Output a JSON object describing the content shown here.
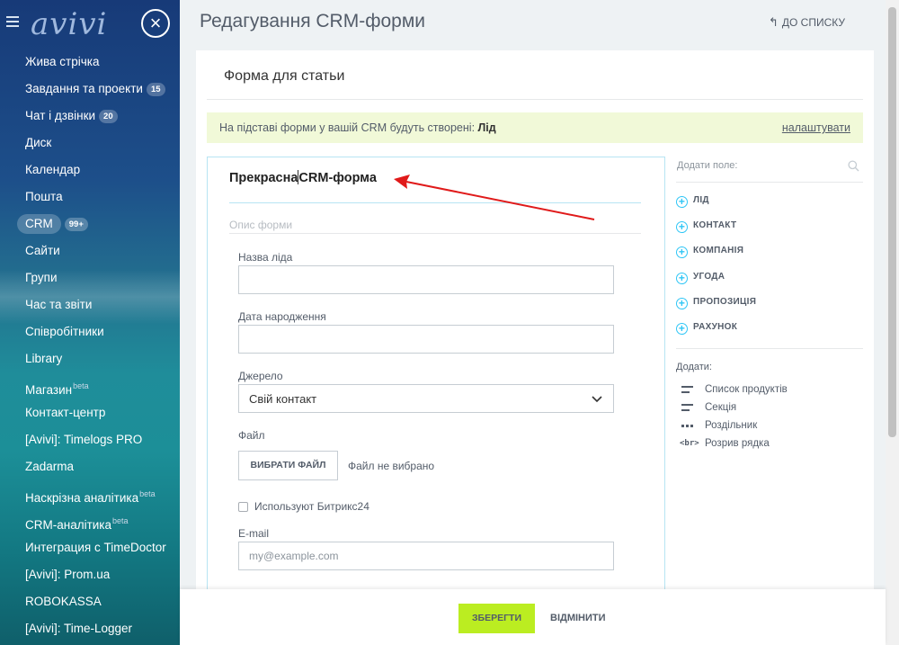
{
  "sidebar": {
    "logo": "avivi",
    "items": [
      {
        "label": "Жива стрічка"
      },
      {
        "label": "Завдання та проекти",
        "badge": "15"
      },
      {
        "label": "Чат і дзвінки",
        "badge": "20"
      },
      {
        "label": "Диск"
      },
      {
        "label": "Календар"
      },
      {
        "label": "Пошта"
      },
      {
        "label": "CRM",
        "badge": "99+"
      },
      {
        "label": "Сайти"
      },
      {
        "label": "Групи"
      },
      {
        "label": "Час та звіти"
      },
      {
        "label": "Співробітники"
      },
      {
        "label": "Library"
      },
      {
        "label": "Магазин",
        "sup": "beta"
      },
      {
        "label": "Контакт-центр"
      },
      {
        "label": "[Avivi]: Timelogs PRO"
      },
      {
        "label": "Zadarma"
      },
      {
        "label": "Наскрізна аналітика",
        "sup": "beta"
      },
      {
        "label": "CRM-аналітика",
        "sup": "beta"
      },
      {
        "label": "Интеграция с TimeDoctor"
      },
      {
        "label": "[Avivi]: Prom.ua"
      },
      {
        "label": "ROBOKASSA"
      },
      {
        "label": "[Avivi]: Time-Logger"
      }
    ]
  },
  "header": {
    "title": "Редагування CRM-форми",
    "back_label": "ДО СПИСКУ"
  },
  "card": {
    "title": "Форма для статьи",
    "info_text": "На підставі форми у вашій CRM будуть створені:",
    "info_entity": "Лід",
    "info_link": "налаштувати"
  },
  "form": {
    "name_before_cursor": "Прекрасна",
    "name_after_cursor": "CRM-форма",
    "description_placeholder": "Опис форми",
    "fields": {
      "lead_name_label": "Назва ліда",
      "birthdate_label": "Дата народження",
      "source_label": "Джерело",
      "source_value": "Свій контакт",
      "file_label": "Файл",
      "file_button": "ВИБРАТИ ФАЙЛ",
      "file_status": "Файл не вибрано",
      "checkbox_label": "Используют Битрикс24",
      "email_label": "E-mail",
      "email_placeholder": "my@example.com"
    }
  },
  "right_panel": {
    "search_placeholder": "Додати поле:",
    "entities": [
      "ЛІД",
      "КОНТАКТ",
      "КОМПАНІЯ",
      "УГОДА",
      "ПРОПОЗИЦІЯ",
      "РАХУНОК"
    ],
    "add_label": "Додати:",
    "extras": [
      {
        "label": "Список продуктів",
        "icon": "product-list-icon"
      },
      {
        "label": "Секція",
        "icon": "section-icon"
      },
      {
        "label": "Роздільник",
        "icon": "divider-icon"
      },
      {
        "label": "Розрив рядка",
        "icon": "line-break-icon",
        "icon_text": "<br>"
      }
    ]
  },
  "footer": {
    "save_label": "ЗБЕРЕГТИ",
    "cancel_label": "ВІДМІНИТИ"
  },
  "colors": {
    "save_green": "#bbed21",
    "info_bg": "#f1f9d8",
    "form_border": "#b7e4f3",
    "plus_accent": "#2fc6f6",
    "annotation_red": "#e01a1a"
  }
}
